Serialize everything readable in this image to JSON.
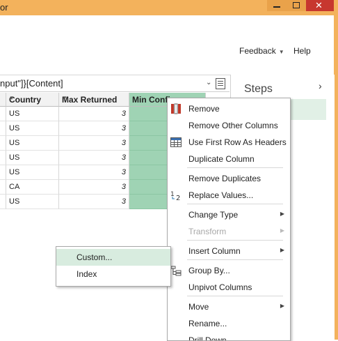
{
  "window": {
    "title": "or"
  },
  "ribbon": {
    "feedback_label": "Feedback",
    "help_label": "Help"
  },
  "formula_bar": {
    "text": "nput\"]}[Content]"
  },
  "steps_pane": {
    "title": "Steps"
  },
  "table": {
    "columns": [
      "",
      "Country",
      "Max Returned",
      "Min Confic"
    ],
    "rows": [
      [
        "",
        "US",
        "3",
        ""
      ],
      [
        "",
        "US",
        "3",
        ""
      ],
      [
        "",
        "US",
        "3",
        ""
      ],
      [
        "",
        "US",
        "3",
        ""
      ],
      [
        "",
        "US",
        "3",
        ""
      ],
      [
        "",
        "CA",
        "3",
        ""
      ],
      [
        "",
        "US",
        "3",
        ""
      ]
    ],
    "selected_column": "Min Confic",
    "selection_color": "#9fd3b4"
  },
  "context_menu": {
    "items": [
      {
        "label": "Remove",
        "icon": "remove-columns-icon"
      },
      {
        "label": "Remove Other Columns"
      },
      {
        "label": "Use First Row As Headers",
        "icon": "table-headers-icon"
      },
      {
        "label": "Duplicate Column"
      },
      {
        "label": "Remove Duplicates"
      },
      {
        "label": "Replace Values...",
        "icon": "replace-values-icon"
      },
      {
        "label": "Change Type",
        "submenu": true
      },
      {
        "label": "Transform",
        "submenu": true,
        "disabled": true
      },
      {
        "label": "Insert Column",
        "submenu": true
      },
      {
        "label": "Group By...",
        "icon": "group-by-icon"
      },
      {
        "label": "Unpivot Columns"
      },
      {
        "label": "Move",
        "submenu": true
      },
      {
        "label": "Rename..."
      },
      {
        "label": "Drill Down"
      }
    ]
  },
  "submenu": {
    "items": [
      {
        "label": "Custom...",
        "highlighted": true
      },
      {
        "label": "Index"
      }
    ]
  },
  "colors": {
    "title_bar": "#f3b25c",
    "close_button": "#c7372f",
    "accent_green": "#9fd3b4"
  }
}
